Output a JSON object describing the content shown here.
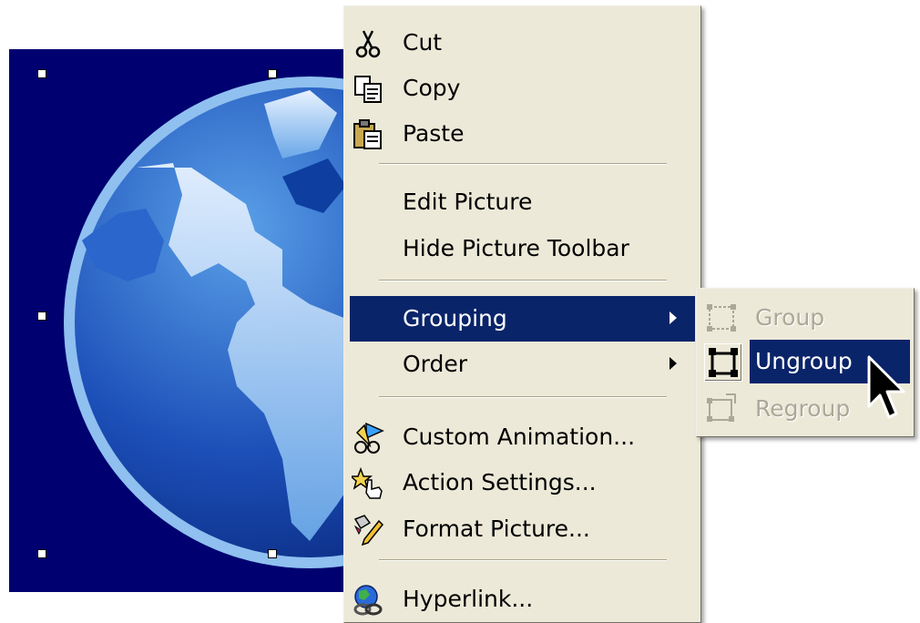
{
  "context_menu": {
    "cut": "Cut",
    "copy": "Copy",
    "paste": "Paste",
    "edit_picture": "Edit Picture",
    "hide_toolbar": "Hide Picture Toolbar",
    "grouping": "Grouping",
    "order": "Order",
    "custom_animation": "Custom Animation...",
    "action_settings": "Action Settings...",
    "format_picture": "Format Picture...",
    "hyperlink": "Hyperlink..."
  },
  "submenu": {
    "group": "Group",
    "ungroup": "Ungroup",
    "regroup": "Regroup"
  },
  "colors": {
    "menu_bg": "#ece9d8",
    "highlight": "#0a246a",
    "picture_bg": "#000070",
    "disabled_text": "#aca899"
  },
  "icons": [
    "scissors-icon",
    "copy-icon",
    "paste-icon",
    "custom-animation-icon",
    "action-settings-icon",
    "format-picture-icon",
    "hyperlink-icon",
    "group-icon",
    "ungroup-icon",
    "regroup-icon",
    "arrow-cursor"
  ]
}
